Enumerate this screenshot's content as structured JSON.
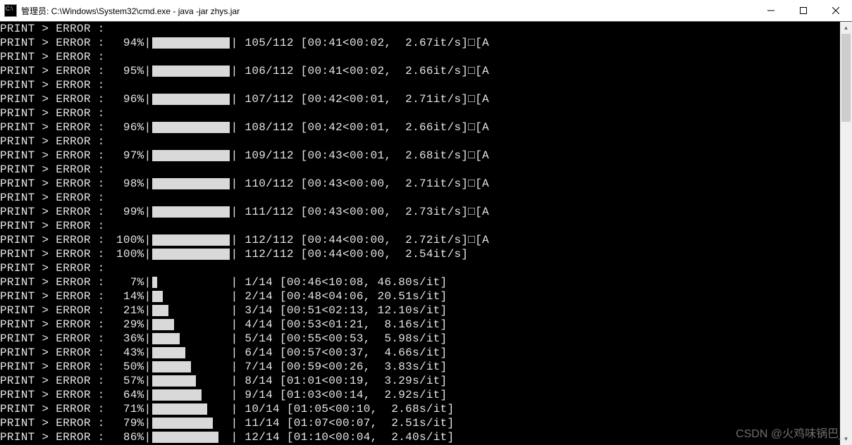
{
  "window": {
    "title": "管理员: C:\\Windows\\System32\\cmd.exe - java  -jar zhys.jar"
  },
  "prefix": "PRINT > ERROR :",
  "lines": [
    {
      "type": "plain"
    },
    {
      "type": "prog",
      "pct": "94%",
      "bar": 100,
      "stats": " 105/112 [00:41<00:02,  2.67it/s]",
      "tail": "□[A"
    },
    {
      "type": "plain"
    },
    {
      "type": "prog",
      "pct": "95%",
      "bar": 100,
      "stats": " 106/112 [00:41<00:02,  2.66it/s]",
      "tail": "□[A"
    },
    {
      "type": "plain"
    },
    {
      "type": "prog",
      "pct": "96%",
      "bar": 100,
      "stats": " 107/112 [00:42<00:01,  2.71it/s]",
      "tail": "□[A"
    },
    {
      "type": "plain"
    },
    {
      "type": "prog",
      "pct": "96%",
      "bar": 100,
      "stats": " 108/112 [00:42<00:01,  2.66it/s]",
      "tail": "□[A"
    },
    {
      "type": "plain"
    },
    {
      "type": "prog",
      "pct": "97%",
      "bar": 100,
      "stats": " 109/112 [00:43<00:01,  2.68it/s]",
      "tail": "□[A"
    },
    {
      "type": "plain"
    },
    {
      "type": "prog",
      "pct": "98%",
      "bar": 100,
      "stats": " 110/112 [00:43<00:00,  2.71it/s]",
      "tail": "□[A"
    },
    {
      "type": "plain"
    },
    {
      "type": "prog",
      "pct": "99%",
      "bar": 100,
      "stats": " 111/112 [00:43<00:00,  2.73it/s]",
      "tail": "□[A"
    },
    {
      "type": "plain"
    },
    {
      "type": "prog",
      "pct": "100%",
      "bar": 100,
      "stats": " 112/112 [00:44<00:00,  2.72it/s]",
      "tail": "□[A"
    },
    {
      "type": "prog",
      "pct": "100%",
      "bar": 100,
      "stats": " 112/112 [00:44<00:00,  2.54it/s]",
      "tail": ""
    },
    {
      "type": "plain"
    },
    {
      "type": "prog",
      "pct": "7%",
      "bar": 7,
      "stats": " 1/14 [00:46<10:08, 46.80s/it]",
      "tail": ""
    },
    {
      "type": "prog",
      "pct": "14%",
      "bar": 14,
      "stats": " 2/14 [00:48<04:06, 20.51s/it]",
      "tail": ""
    },
    {
      "type": "prog",
      "pct": "21%",
      "bar": 21,
      "stats": " 3/14 [00:51<02:13, 12.10s/it]",
      "tail": ""
    },
    {
      "type": "prog",
      "pct": "29%",
      "bar": 29,
      "stats": " 4/14 [00:53<01:21,  8.16s/it]",
      "tail": ""
    },
    {
      "type": "prog",
      "pct": "36%",
      "bar": 36,
      "stats": " 5/14 [00:55<00:53,  5.98s/it]",
      "tail": ""
    },
    {
      "type": "prog",
      "pct": "43%",
      "bar": 43,
      "stats": " 6/14 [00:57<00:37,  4.66s/it]",
      "tail": ""
    },
    {
      "type": "prog",
      "pct": "50%",
      "bar": 50,
      "stats": " 7/14 [00:59<00:26,  3.83s/it]",
      "tail": ""
    },
    {
      "type": "prog",
      "pct": "57%",
      "bar": 57,
      "stats": " 8/14 [01:01<00:19,  3.29s/it]",
      "tail": ""
    },
    {
      "type": "prog",
      "pct": "64%",
      "bar": 64,
      "stats": " 9/14 [01:03<00:14,  2.92s/it]",
      "tail": ""
    },
    {
      "type": "prog",
      "pct": "71%",
      "bar": 71,
      "stats": " 10/14 [01:05<00:10,  2.68s/it]",
      "tail": ""
    },
    {
      "type": "prog",
      "pct": "79%",
      "bar": 79,
      "stats": " 11/14 [01:07<00:07,  2.51s/it]",
      "tail": ""
    },
    {
      "type": "prog",
      "pct": "86%",
      "bar": 86,
      "stats": " 12/14 [01:10<00:04,  2.40s/it]",
      "tail": ""
    }
  ],
  "watermark": "CSDN @火鸡味锅巴_",
  "scrollbar": {
    "thumb_top_pct": 0,
    "thumb_height_pct": 22
  }
}
